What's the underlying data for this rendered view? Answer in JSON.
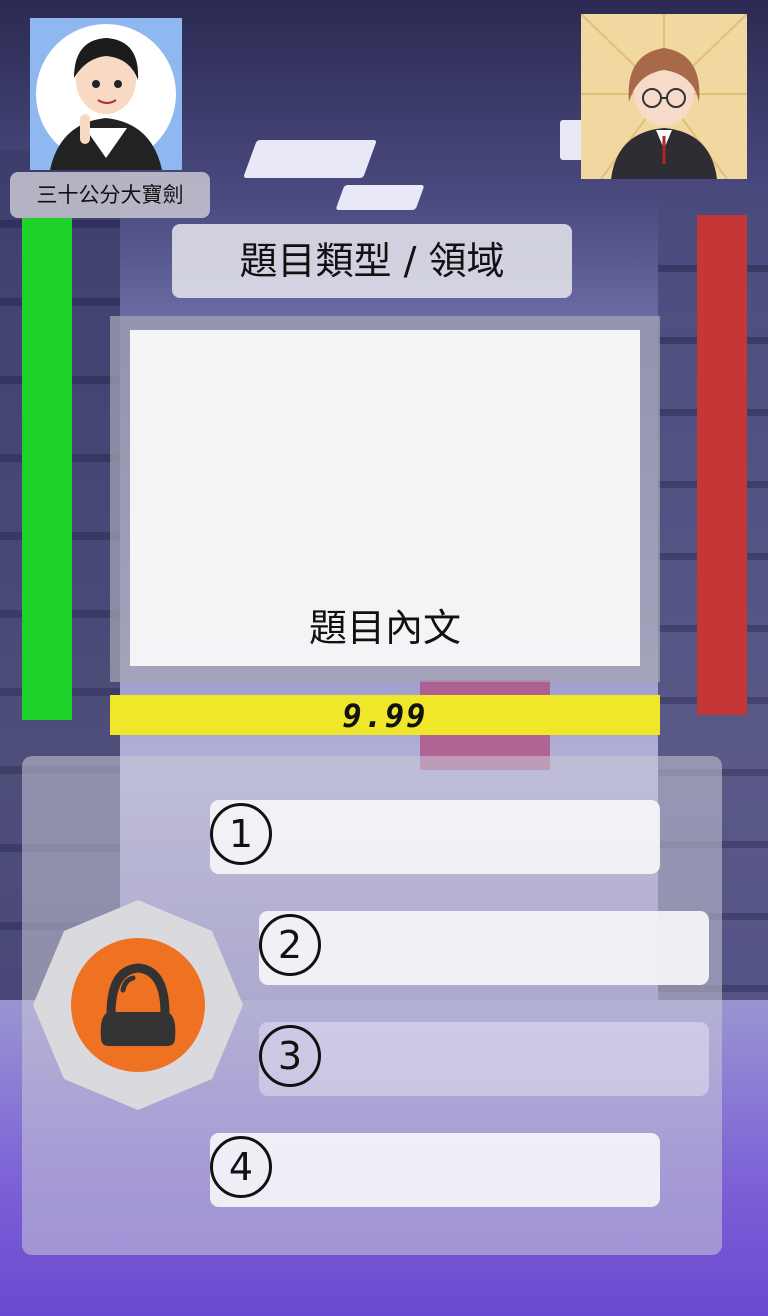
{
  "players": {
    "left": {
      "name": "三十公分大寶劍",
      "hp_fraction": 1.0,
      "hp_color": "#1fd22a"
    },
    "right": {
      "hp_fraction": 1.0,
      "hp_color": "#c53636"
    }
  },
  "question": {
    "type_label": "題目類型 / 領域",
    "body": "題目內文"
  },
  "timer": {
    "value": "9.99",
    "color": "#f0e62a"
  },
  "options": [
    {
      "number": "1",
      "text": ""
    },
    {
      "number": "2",
      "text": ""
    },
    {
      "number": "3",
      "text": ""
    },
    {
      "number": "4",
      "text": ""
    }
  ],
  "buzzer": {
    "icon": "buzzer-icon",
    "color": "#ee7222"
  }
}
